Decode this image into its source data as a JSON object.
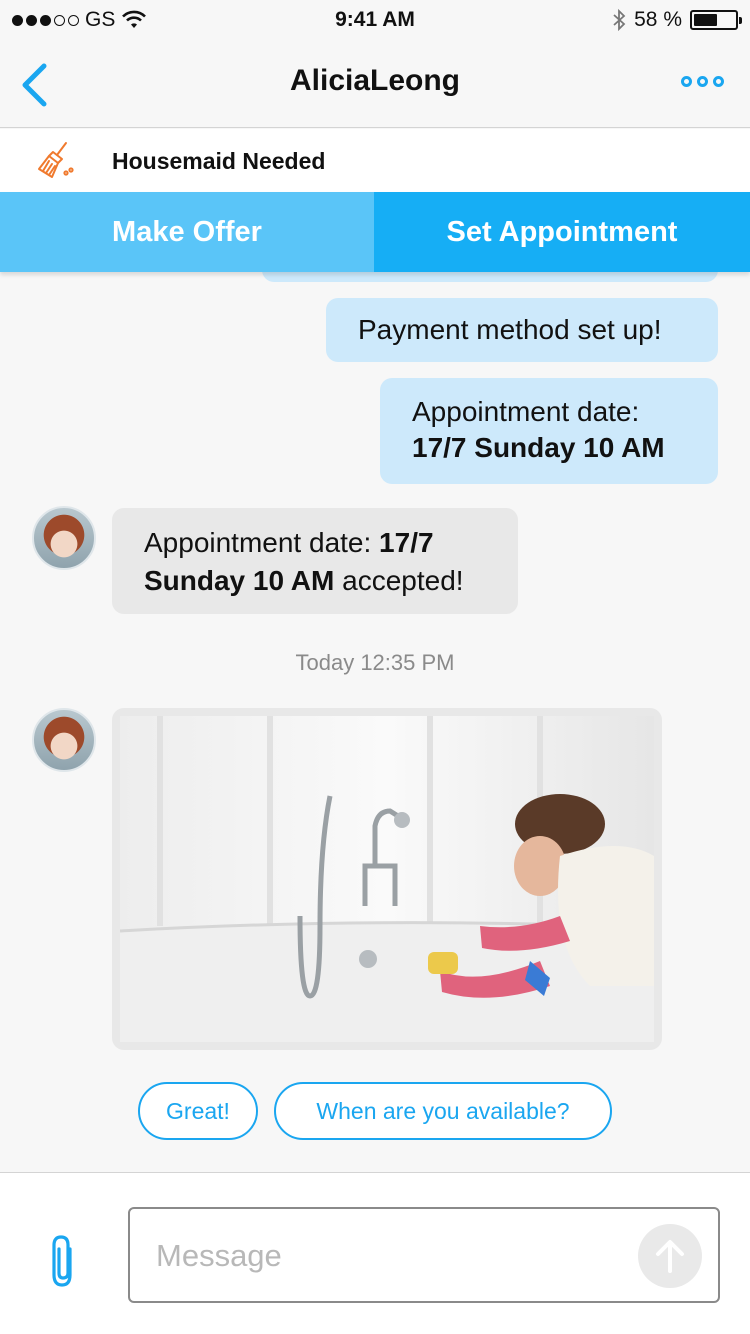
{
  "status_bar": {
    "carrier": "GS",
    "time": "9:41 AM",
    "battery_percent": "58 %",
    "battery_level": 0.58,
    "signal_bars_filled": 3,
    "signal_bars_total": 5
  },
  "nav": {
    "title": "AliciaLeong"
  },
  "job": {
    "title": "Housemaid Needed",
    "icon": "broom-icon"
  },
  "actions": {
    "make_offer": "Make Offer",
    "set_appointment": "Set Appointment"
  },
  "messages": {
    "payment": "Payment method set up!",
    "appt_sent_line1": "Appointment date:",
    "appt_sent_line2": "17/7 Sunday 10 AM",
    "appt_reply_prefix": "Appointment date: ",
    "appt_reply_bold1": "17/7",
    "appt_reply_bold2": "Sunday 10 AM",
    "appt_reply_suffix": " accepted!",
    "timestamp": "Today 12:35 PM"
  },
  "quick_replies": [
    "Great!",
    "When are you available?"
  ],
  "input": {
    "placeholder": "Message"
  },
  "colors": {
    "accent": "#1aa6f0",
    "make_offer_bg": "#5ac5f8",
    "set_appointment_bg": "#16aef5",
    "outgoing_bubble": "#cde9fb",
    "incoming_bubble": "#e8e8e8",
    "job_icon": "#f07a2e"
  }
}
